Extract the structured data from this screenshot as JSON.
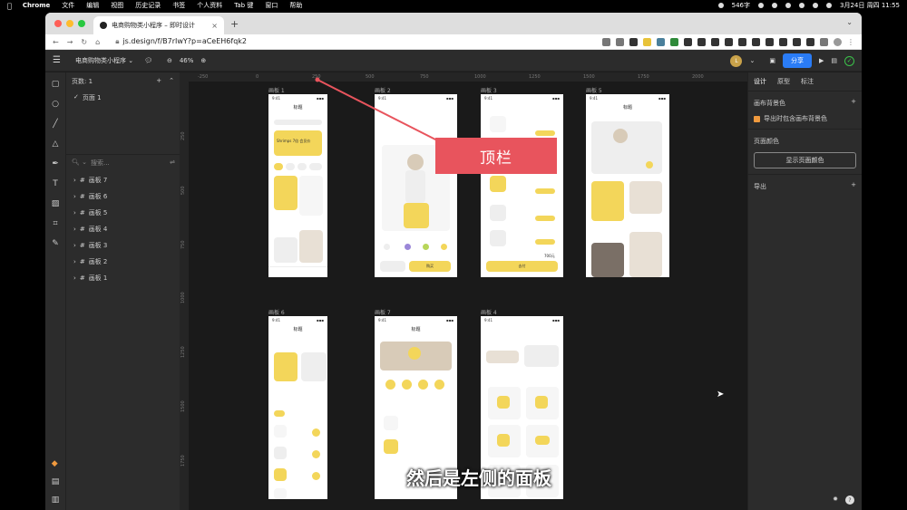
{
  "menubar": {
    "app": "Chrome",
    "items": [
      "文件",
      "编辑",
      "视图",
      "历史记录",
      "书签",
      "个人资料",
      "Tab 键",
      "窗口",
      "帮助"
    ],
    "status": "546字",
    "datetime": "3月24日 周四 11:55"
  },
  "browser": {
    "tab_title": "电商购物类小程序 – 即时设计",
    "url": "js.design/f/B7rIwY?p=aCeEH6fqk2"
  },
  "toolbar": {
    "project": "电商购物类小程序",
    "zoom": "46%",
    "avatar": "L",
    "share": "分享"
  },
  "layers": {
    "pages_header": "页数: 1",
    "page_item": "页面 1",
    "search_placeholder": "搜索...",
    "boards": [
      "画板 7",
      "画板 6",
      "画板 5",
      "画板 4",
      "画板 3",
      "画板 2",
      "画板 1"
    ]
  },
  "canvas": {
    "ruler_top": [
      "-250",
      "0",
      "250",
      "500",
      "750",
      "1000",
      "1250",
      "1500",
      "1750",
      "2000"
    ],
    "ruler_left": [
      "250",
      "500",
      "750",
      "1000",
      "1250",
      "1500",
      "1750"
    ],
    "frames_row1": [
      "画板 1",
      "画板 2",
      "画板 3",
      "画板 5"
    ],
    "frames_row2": [
      "画板 6",
      "画板 7",
      "画板 4"
    ],
    "frame_title": "标题",
    "f1_banner": "Shrimps 7倍 会员价",
    "f3_price": "700元",
    "f3_btn": "去付",
    "f2_btn": "购买",
    "callout": "顶栏",
    "subtitle": "然后是左侧的面板"
  },
  "rightpanel": {
    "tabs": [
      "设计",
      "原型",
      "标注"
    ],
    "bg_title": "画布背景色",
    "bg_check": "导出时包含画布背景色",
    "page_color": "页面颜色",
    "page_color_btn": "显示页面颜色",
    "export": "导出"
  },
  "colors": {
    "accent_blue": "#2a7cf6",
    "callout_red": "#e8545d",
    "product_yellow": "#f3d65a"
  }
}
